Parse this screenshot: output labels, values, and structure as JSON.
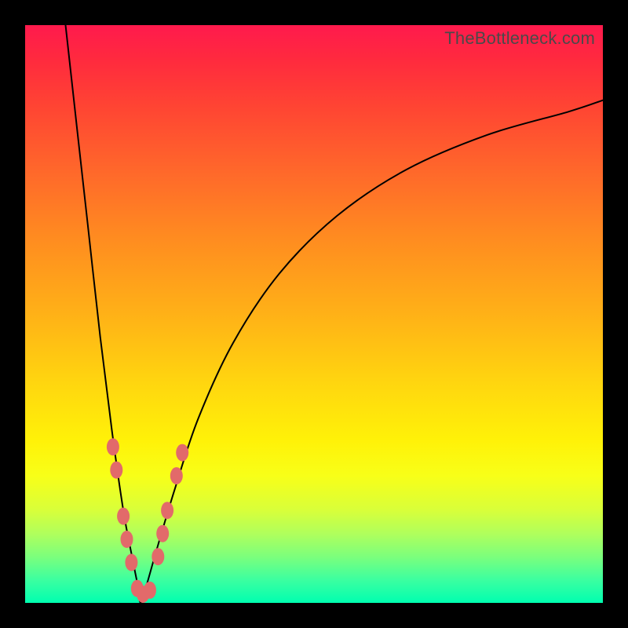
{
  "watermark": "TheBottleneck.com",
  "chart_data": {
    "type": "line",
    "title": "",
    "xlabel": "",
    "ylabel": "",
    "xlim": [
      0,
      100
    ],
    "ylim": [
      0,
      100
    ],
    "grid": false,
    "legend": false,
    "notes": "V-shaped bottleneck curve. Axes unlabeled; values are approximate pixel-fraction percentages (x = position across plot, y = distance-from-optimum metric, 0 at bottom). Minimum near x≈20. Tick marks and numeric labels are absent in the source image.",
    "series": [
      {
        "name": "left-branch",
        "x": [
          7,
          9,
          11,
          13,
          15,
          17,
          18.5,
          19.5,
          20
        ],
        "y": [
          100,
          82,
          64,
          46,
          30,
          16,
          8,
          3,
          0
        ]
      },
      {
        "name": "right-branch",
        "x": [
          20,
          21,
          23,
          26,
          30,
          36,
          44,
          54,
          66,
          80,
          94,
          100
        ],
        "y": [
          0,
          3,
          10,
          20,
          32,
          45,
          57,
          67,
          75,
          81,
          85,
          87
        ]
      }
    ],
    "highlight_points": {
      "note": "Pink dot markers clustered near the minimum on both branches",
      "points": [
        {
          "x": 15.2,
          "y": 27
        },
        {
          "x": 15.8,
          "y": 23
        },
        {
          "x": 17.0,
          "y": 15
        },
        {
          "x": 17.6,
          "y": 11
        },
        {
          "x": 18.4,
          "y": 7
        },
        {
          "x": 19.4,
          "y": 2.5
        },
        {
          "x": 20.4,
          "y": 1.5
        },
        {
          "x": 21.6,
          "y": 2.2
        },
        {
          "x": 23.0,
          "y": 8
        },
        {
          "x": 23.8,
          "y": 12
        },
        {
          "x": 24.6,
          "y": 16
        },
        {
          "x": 26.2,
          "y": 22
        },
        {
          "x": 27.2,
          "y": 26
        }
      ]
    }
  }
}
